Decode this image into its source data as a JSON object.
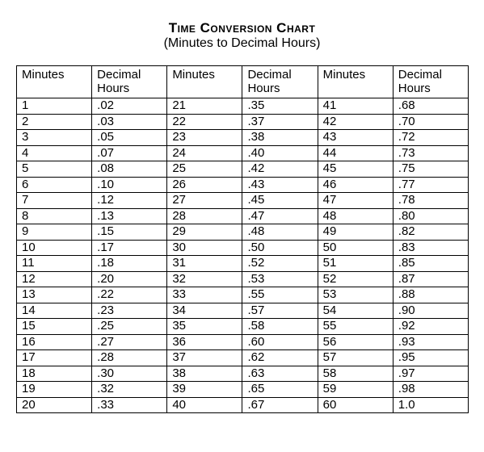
{
  "title": "Time Conversion Chart",
  "subtitle": "(Minutes to Decimal Hours)",
  "headers": {
    "minutes": "Minutes",
    "decimal_line1": "Decimal",
    "decimal_line2": "Hours"
  },
  "chart_data": {
    "type": "table",
    "title": "Time Conversion Chart (Minutes to Decimal Hours)",
    "columns": [
      "Minutes",
      "Decimal Hours"
    ],
    "rows": [
      [
        1,
        ".02"
      ],
      [
        2,
        ".03"
      ],
      [
        3,
        ".05"
      ],
      [
        4,
        ".07"
      ],
      [
        5,
        ".08"
      ],
      [
        6,
        ".10"
      ],
      [
        7,
        ".12"
      ],
      [
        8,
        ".13"
      ],
      [
        9,
        ".15"
      ],
      [
        10,
        ".17"
      ],
      [
        11,
        ".18"
      ],
      [
        12,
        ".20"
      ],
      [
        13,
        ".22"
      ],
      [
        14,
        ".23"
      ],
      [
        15,
        ".25"
      ],
      [
        16,
        ".27"
      ],
      [
        17,
        ".28"
      ],
      [
        18,
        ".30"
      ],
      [
        19,
        ".32"
      ],
      [
        20,
        ".33"
      ],
      [
        21,
        ".35"
      ],
      [
        22,
        ".37"
      ],
      [
        23,
        ".38"
      ],
      [
        24,
        ".40"
      ],
      [
        25,
        ".42"
      ],
      [
        26,
        ".43"
      ],
      [
        27,
        ".45"
      ],
      [
        28,
        ".47"
      ],
      [
        29,
        ".48"
      ],
      [
        30,
        ".50"
      ],
      [
        31,
        ".52"
      ],
      [
        32,
        ".53"
      ],
      [
        33,
        ".55"
      ],
      [
        34,
        ".57"
      ],
      [
        35,
        ".58"
      ],
      [
        36,
        ".60"
      ],
      [
        37,
        ".62"
      ],
      [
        38,
        ".63"
      ],
      [
        39,
        ".65"
      ],
      [
        40,
        ".67"
      ],
      [
        41,
        ".68"
      ],
      [
        42,
        ".70"
      ],
      [
        43,
        ".72"
      ],
      [
        44,
        ".73"
      ],
      [
        45,
        ".75"
      ],
      [
        46,
        ".77"
      ],
      [
        47,
        ".78"
      ],
      [
        48,
        ".80"
      ],
      [
        49,
        ".82"
      ],
      [
        50,
        ".83"
      ],
      [
        51,
        ".85"
      ],
      [
        52,
        ".87"
      ],
      [
        53,
        ".88"
      ],
      [
        54,
        ".90"
      ],
      [
        55,
        ".92"
      ],
      [
        56,
        ".93"
      ],
      [
        57,
        ".95"
      ],
      [
        58,
        ".97"
      ],
      [
        59,
        ".98"
      ],
      [
        60,
        "1.0"
      ]
    ]
  }
}
